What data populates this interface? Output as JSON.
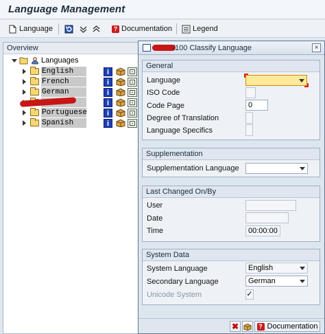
{
  "window": {
    "title": "Language Management"
  },
  "toolbar": {
    "language_label": "Language",
    "documentation_label": "Documentation",
    "legend_label": "Legend"
  },
  "tree": {
    "header": "Overview",
    "root_label": "Languages",
    "items": [
      {
        "label": "English"
      },
      {
        "label": "French"
      },
      {
        "label": "German"
      },
      {
        "label": ""
      },
      {
        "label": "Portuguese"
      },
      {
        "label": "Spanish"
      }
    ]
  },
  "dialog": {
    "title": "/100 Classify Language",
    "close_label": "×",
    "general": {
      "header": "General",
      "language_label": "Language",
      "language_value": "",
      "iso_code_label": "ISO Code",
      "code_page_label": "Code Page",
      "code_page_value": "0",
      "degree_label": "Degree of Translation",
      "specifics_label": "Language Specifics"
    },
    "supplementation": {
      "header": "Supplementation",
      "supp_language_label": "Supplementation Language",
      "supp_language_value": ""
    },
    "last_changed": {
      "header": "Last Changed On/By",
      "user_label": "User",
      "date_label": "Date",
      "time_label": "Time",
      "time_value": "00:00:00"
    },
    "system_data": {
      "header": "System Data",
      "system_language_label": "System Language",
      "system_language_value": "English",
      "secondary_language_label": "Secondary Language",
      "secondary_language_value": "German",
      "unicode_label": "Unicode System",
      "unicode_checked": "✓"
    },
    "footer": {
      "documentation_label": "Documentation"
    }
  },
  "colors": {
    "required_field_bg": "#ffe99a",
    "info_icon_blue": "#1d3fb2",
    "cancel_red": "#c40000"
  }
}
